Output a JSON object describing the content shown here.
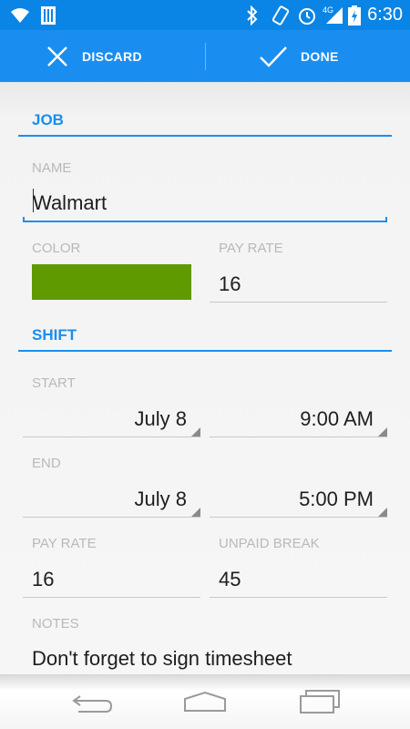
{
  "status": {
    "time": "6:30",
    "network": "4G"
  },
  "actions": {
    "discard": "DISCARD",
    "done": "DONE"
  },
  "job": {
    "title": "JOB",
    "name_label": "NAME",
    "name_value": "Walmart",
    "color_label": "COLOR",
    "color_value": "#5e9a00",
    "pay_rate_label": "PAY RATE",
    "pay_rate_value": "16"
  },
  "shift": {
    "title": "SHIFT",
    "start_label": "START",
    "start_date": "July 8",
    "start_time": "9:00 AM",
    "end_label": "END",
    "end_date": "July 8",
    "end_time": "5:00 PM",
    "pay_rate_label": "PAY RATE",
    "pay_rate_value": "16",
    "break_label": "UNPAID BREAK",
    "break_value": "45",
    "notes_label": "NOTES",
    "notes_value": "Don't forget to sign timesheet"
  }
}
